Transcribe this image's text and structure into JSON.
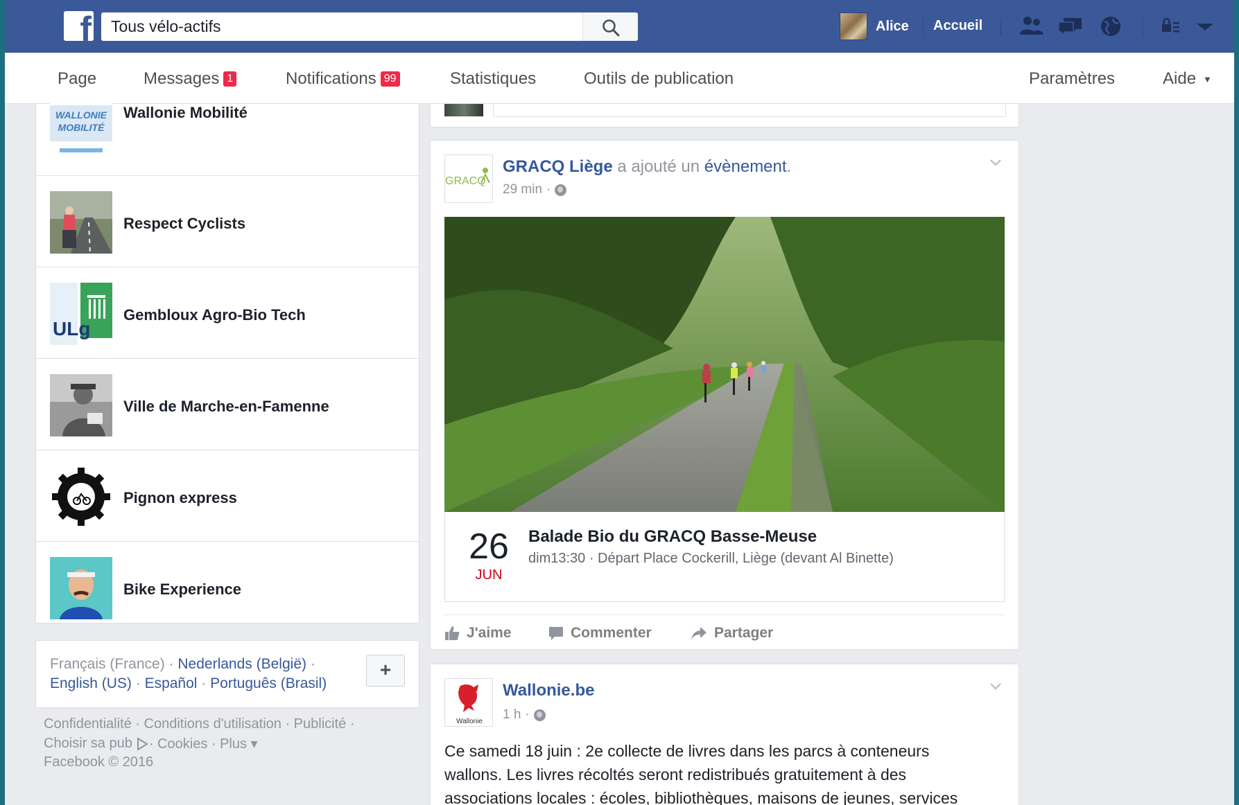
{
  "search": {
    "value": "Tous vélo-actifs"
  },
  "topbar": {
    "logo": "f",
    "user_name": "Alice",
    "home": "Accueil",
    "icons": [
      "friend-requests-icon",
      "messages-icon",
      "notifications-globe-icon",
      "privacy-lock-icon",
      "account-menu-icon"
    ]
  },
  "pagenav": {
    "page": "Page",
    "messages": "Messages",
    "messages_badge": "1",
    "notifications": "Notifications",
    "notifications_badge": "99",
    "stats": "Statistiques",
    "publishing_tools": "Outils de publication",
    "settings": "Paramètres",
    "help": "Aide",
    "help_caret": "▼"
  },
  "left_list": {
    "items": [
      {
        "label": "Wallonie Mobilité",
        "thumb_text": [
          "WALLONIE",
          "MOBILITÉ"
        ]
      },
      {
        "label": "Respect Cyclists"
      },
      {
        "label": "Gembloux Agro-Bio Tech",
        "thumb_text": "ULg"
      },
      {
        "label": "Ville de Marche-en-Famenne"
      },
      {
        "label": "Pignon express"
      },
      {
        "label": "Bike Experience"
      }
    ]
  },
  "languages": {
    "current": "Français (France)",
    "links": [
      "Nederlands (België)",
      "English (US)",
      "Español",
      "Português (Brasil)"
    ],
    "sep": "·",
    "add": "+"
  },
  "footer": {
    "line1": "Confidentialité · Conditions d'utilisation · Publicité ·",
    "line2a": "Choisir sa pub",
    "line2b": " · Cookies · Plus ▾",
    "line3": "Facebook © 2016"
  },
  "posts": [
    {
      "author": "GRACQ Liège",
      "action": " a ajouté un ",
      "action_link": "évènement",
      "action_end": ".",
      "time": "29 min",
      "logo_text": "GRACQ",
      "event": {
        "day": "26",
        "month": "JUN",
        "title": "Balade Bio du GRACQ Basse-Meuse",
        "subtitle": "dim13:30 · Départ Place Cockerill, Liège (devant Al Binette)"
      },
      "actions": {
        "like": "J'aime",
        "comment": "Commenter",
        "share": "Partager"
      }
    },
    {
      "author": "Wallonie.be",
      "time": "1 h",
      "logo_text": "Wallonie",
      "text_lines": [
        "Ce samedi 18 juin : 2e collecte de livres dans les parcs à conteneurs",
        "wallons. Les livres récoltés seront redistribués gratuitement à des",
        "associations locales : écoles, bibliothèques, maisons de jeunes, services"
      ]
    }
  ],
  "colors": {
    "brand_blue": "#3b5998",
    "link_blue": "#365899",
    "badge_red": "#f02849",
    "frame_teal": "#1d6f80",
    "event_month_red": "#d0021b"
  }
}
